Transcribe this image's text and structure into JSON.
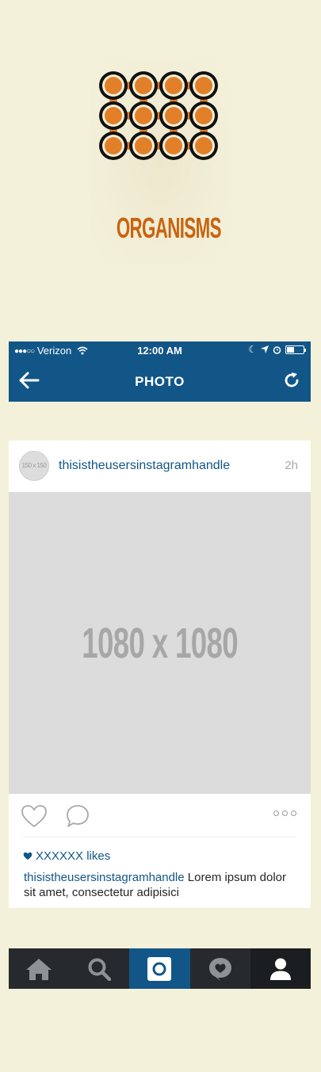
{
  "logo": {
    "title": "ORGANISMS",
    "colors": {
      "orange": "#e2802a",
      "dark": "#111111",
      "text": "#c8640f"
    }
  },
  "status_bar": {
    "signal": "●●●○○",
    "carrier": "Verizon",
    "time": "12:00 AM"
  },
  "nav": {
    "title": "PHOTO",
    "back_icon": "arrow-left-icon",
    "refresh_icon": "refresh-icon"
  },
  "post": {
    "avatar_placeholder": "150 x 150",
    "handle": "thisistheusersinstagramhandle",
    "timestamp": "2h",
    "photo_placeholder": "1080 x 1080",
    "likes": "XXXXXX likes",
    "caption_handle": "thisistheusersinstagramhandle",
    "caption_text": " Lorem ipsum dolor sit amet, consectetur adipisici"
  },
  "tabbar": {
    "tabs": [
      {
        "name": "home",
        "icon": "home-icon"
      },
      {
        "name": "search",
        "icon": "search-icon"
      },
      {
        "name": "camera",
        "icon": "camera-icon",
        "active": true
      },
      {
        "name": "activity",
        "icon": "activity-heart-bubble-icon"
      },
      {
        "name": "profile",
        "icon": "profile-icon"
      }
    ]
  },
  "theme": {
    "brand_blue": "#125688",
    "background": "#f4f1da",
    "tabbar_dark": "#262a2f"
  }
}
